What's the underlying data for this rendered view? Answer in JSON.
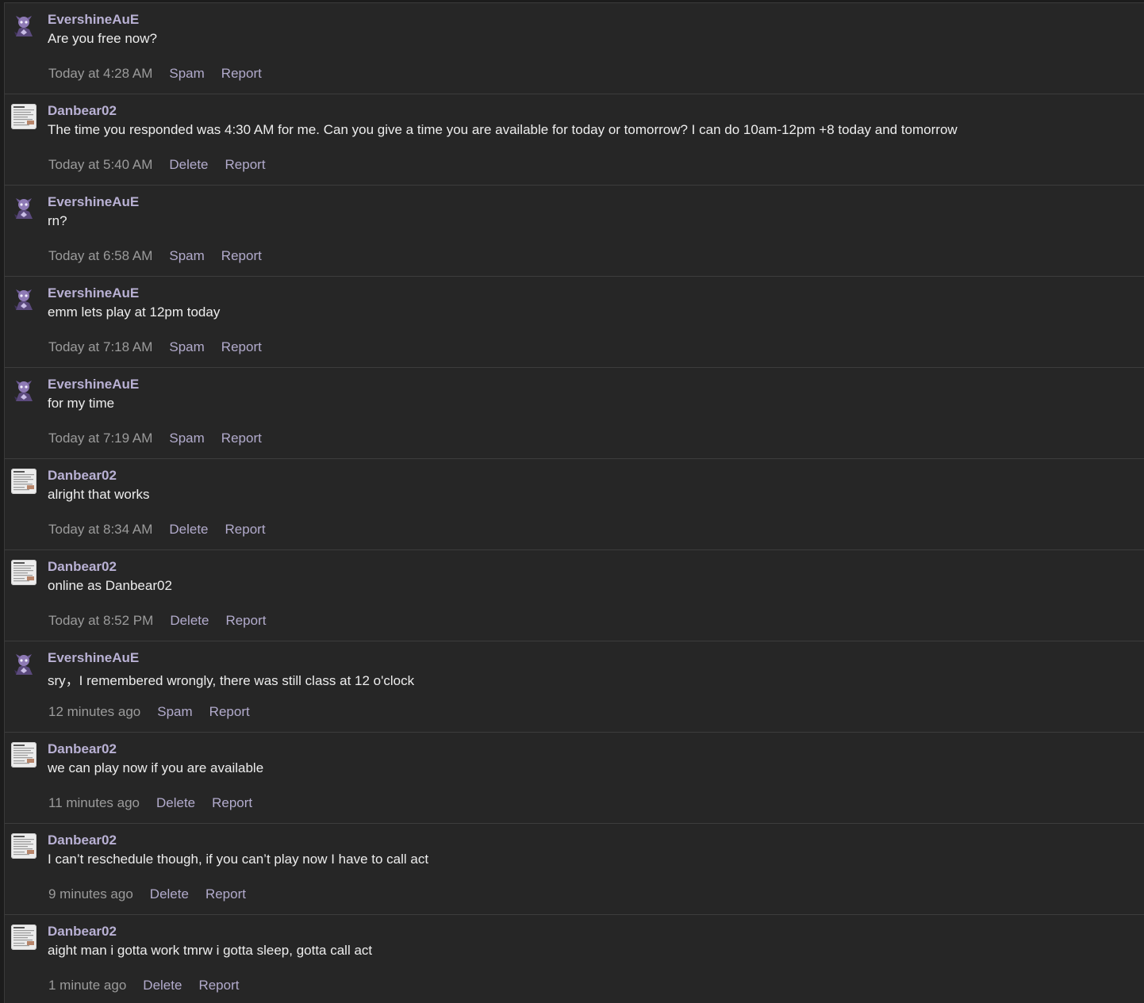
{
  "messages": [
    {
      "author": "EvershineAuE",
      "avatar": "purple-character-avatar",
      "text": "Are you free now?",
      "time": "Today at 4:28 AM",
      "actions": [
        "Spam",
        "Report"
      ]
    },
    {
      "author": "Danbear02",
      "avatar": "document-avatar",
      "text": "The time you responded was 4:30 AM for me. Can you give a time you are available for today or tomorrow? I can do 10am-12pm +8 today and tomorrow",
      "time": "Today at 5:40 AM",
      "actions": [
        "Delete",
        "Report"
      ]
    },
    {
      "author": "EvershineAuE",
      "avatar": "purple-character-avatar",
      "text": "rn?",
      "time": "Today at 6:58 AM",
      "actions": [
        "Spam",
        "Report"
      ]
    },
    {
      "author": "EvershineAuE",
      "avatar": "purple-character-avatar",
      "text": "emm lets play at 12pm today",
      "time": "Today at 7:18 AM",
      "actions": [
        "Spam",
        "Report"
      ]
    },
    {
      "author": "EvershineAuE",
      "avatar": "purple-character-avatar",
      "text": "for my time",
      "time": "Today at 7:19 AM",
      "actions": [
        "Spam",
        "Report"
      ]
    },
    {
      "author": "Danbear02",
      "avatar": "document-avatar",
      "text": "alright that works",
      "time": "Today at 8:34 AM",
      "actions": [
        "Delete",
        "Report"
      ]
    },
    {
      "author": "Danbear02",
      "avatar": "document-avatar",
      "text": "online as Danbear02",
      "time": "Today at 8:52 PM",
      "actions": [
        "Delete",
        "Report"
      ]
    },
    {
      "author": "EvershineAuE",
      "avatar": "purple-character-avatar",
      "text": "sry，I remembered wrongly, there was still class at 12 o'clock",
      "time": "12 minutes ago",
      "actions": [
        "Spam",
        "Report"
      ]
    },
    {
      "author": "Danbear02",
      "avatar": "document-avatar",
      "text": "we can play now if you are available",
      "time": "11 minutes ago",
      "actions": [
        "Delete",
        "Report"
      ]
    },
    {
      "author": "Danbear02",
      "avatar": "document-avatar",
      "text": "I can’t reschedule though, if you can’t play now I have to call act",
      "time": "9 minutes ago",
      "actions": [
        "Delete",
        "Report"
      ]
    },
    {
      "author": "Danbear02",
      "avatar": "document-avatar",
      "text": "aight man i gotta work tmrw i gotta sleep, gotta call act",
      "time": "1 minute ago",
      "actions": [
        "Delete",
        "Report"
      ]
    }
  ]
}
